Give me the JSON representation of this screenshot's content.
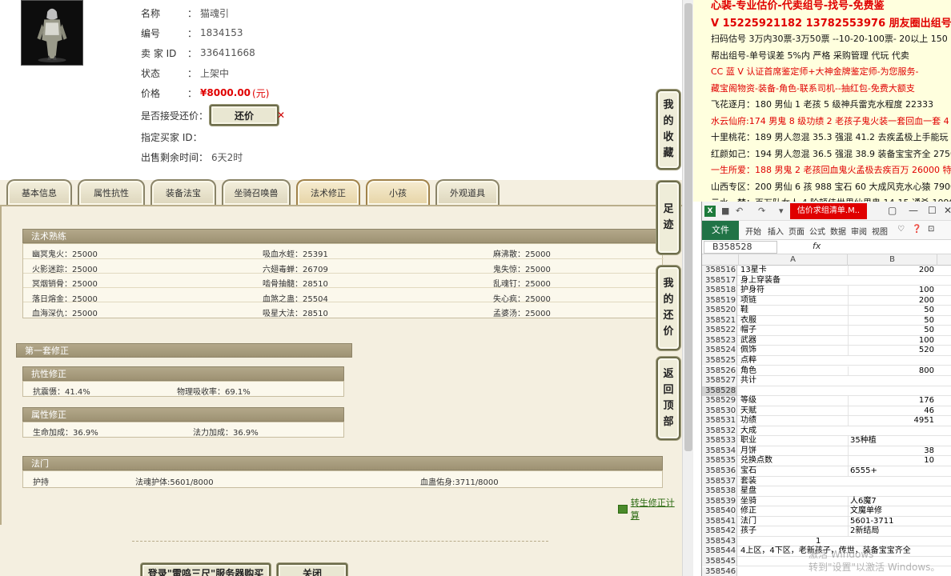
{
  "item": {
    "name_label": [
      "名",
      "称"
    ],
    "name": "猫魂引",
    "id_label": [
      "编",
      "号"
    ],
    "id": "1834153",
    "seller_label": "卖 家 ID",
    "seller_id": "336411668",
    "status_label": [
      "状",
      "态"
    ],
    "status": "上架中",
    "price_label": [
      "价",
      "格"
    ],
    "price": "¥8000.00",
    "price_unit": "(元)",
    "haggle_label": "是否接受还价：",
    "haggle_button": "还价",
    "haggle_x": "✕",
    "buyer_label": "指定买家 ID：",
    "remaining_label": "出售剩余时间：",
    "remaining": "6天2时"
  },
  "tabs": [
    "基本信息",
    "属性抗性",
    "装备法宝",
    "坐骑召唤兽",
    "法术修正",
    "小孩",
    "外观道具"
  ],
  "spell_section": {
    "title": "法术熟练",
    "rows": [
      [
        "幽冥鬼火：25000",
        "吸血水蛭：25391",
        "麻沸散：25000"
      ],
      [
        "火影迷踪：25000",
        "六翅毒蝉：26709",
        "鬼失惊：25000"
      ],
      [
        "冥烟销骨：25000",
        "啮骨抽髓：28510",
        "乱魂钉：25000"
      ],
      [
        "落日熔金：25000",
        "血煞之蛊：25504",
        "失心疯：25000"
      ],
      [
        "血海深仇：25000",
        "吸星大法：28510",
        "孟婆汤：25000"
      ]
    ]
  },
  "correction": {
    "title": "第一套修正",
    "resist_title": "抗性修正",
    "resist_values": [
      "抗震慑：41.4%",
      "物理吸收率：69.1%"
    ],
    "attr_title": "属性修正",
    "attr_values": [
      "生命加成：36.9%",
      "法力加成：36.9%"
    ]
  },
  "magic_door": {
    "title": "法门",
    "values": [
      "护持",
      "法魂护体:5601/8000",
      "血蛊佑身:3711/8000"
    ]
  },
  "side_buttons": [
    "我的收藏",
    "足迹",
    "我的还价",
    "返回顶部"
  ],
  "calc_link": "转生修正计算",
  "bottom_buttons": [
    "登录\"雷鸣三尺\"服务器购买",
    "关闭"
  ],
  "notes": [
    {
      "text": "心裴-专业估价-代卖组号-找号-免费鉴",
      "color": "red",
      "big": true
    },
    {
      "text": "V 15225921182  13782553976 朋友圈出组号",
      "color": "red",
      "big": true
    },
    {
      "text": "扫码估号 3万内30票-3万50票 --10-20-100票- 20以上 150",
      "color": "black"
    },
    {
      "text": "帮出组号-单号误差 5%内 严格 采购管理 代玩 代卖",
      "color": "black"
    },
    {
      "text": "CC 蓝 V 认证首席鉴定师+大神金牌鉴定师-为您服务-",
      "color": "red"
    },
    {
      "text": "藏宝阁物资-装备-角色-联系司机--抽红包-免费大额支",
      "color": "red"
    },
    {
      "text": "飞花逐月：180 男仙 1 老孩 5 级神兵雷克水程度 22333",
      "color": "black"
    },
    {
      "text": "水云仙府:174 男鬼 8 级功绩 2 老孩子鬼火装一套回血一套 4",
      "color": "red"
    },
    {
      "text": "十里桃花：189 男人忽混 35.3 强混 41.2 去疾孟极上手能玩 2",
      "color": "black"
    },
    {
      "text": "红颜如己：194 男人忽混 36.5 强混 38.9 装备宝宝齐全 27500",
      "color": "black"
    },
    {
      "text": "一生所爱：188 男鬼 2 老孩回血鬼火孟极去疾百万 26000 特",
      "color": "red"
    },
    {
      "text": "山西专区：200 男仙 6 孩 988 宝石 60 大成风克水心猿 79000",
      "color": "black"
    },
    {
      "text": "云水一梦：百万队女人 4 阶顿佳世男仙男鬼 14-15 通杀 1090",
      "color": "black"
    }
  ],
  "excel": {
    "doc_title": "估价求组清单.M..",
    "file_tab": "文件",
    "ribbon_tabs": [
      "开始",
      "插入",
      "页面",
      "公式",
      "数据",
      "审阅",
      "视图"
    ],
    "namebox": "B358528",
    "fx": "fx",
    "col_a": "A",
    "col_b": "B",
    "rows": [
      [
        "358516",
        "13星卡",
        "200"
      ],
      [
        "358517",
        "身上穿装备",
        ""
      ],
      [
        "358518",
        "护身符",
        "100"
      ],
      [
        "358519",
        "项链",
        "200"
      ],
      [
        "358520",
        "鞋",
        "50"
      ],
      [
        "358521",
        "衣服",
        "50"
      ],
      [
        "358522",
        "帽子",
        "50"
      ],
      [
        "358523",
        "武器",
        "100"
      ],
      [
        "358524",
        "佩饰",
        "520"
      ],
      [
        "358525",
        "点粹",
        ""
      ],
      [
        "358526",
        "角色",
        "800"
      ],
      [
        "358527",
        "共计",
        ""
      ],
      [
        "358528",
        "",
        ""
      ],
      [
        "358529",
        "等级",
        "176"
      ],
      [
        "358530",
        "天赋",
        "46"
      ],
      [
        "358531",
        "功绩",
        "4951"
      ],
      [
        "358532",
        "大成",
        ""
      ],
      [
        "358533",
        "职业",
        "35种植"
      ],
      [
        "358534",
        "月饼",
        "38"
      ],
      [
        "358535",
        "兑换点数",
        "10"
      ],
      [
        "358536",
        "宝石",
        "6555+"
      ],
      [
        "358537",
        "套装",
        ""
      ],
      [
        "358538",
        "星盘",
        ""
      ],
      [
        "358539",
        "坐骑",
        "人6魔7"
      ],
      [
        "358540",
        "修正",
        "文魔单修"
      ],
      [
        "358541",
        "法门",
        "5601-3711"
      ],
      [
        "358542",
        "孩子",
        "2新结局"
      ],
      [
        "358543",
        "",
        "1"
      ],
      [
        "358544",
        "4上区，4下区，老新孩子，传世，装备宝宝齐全",
        ""
      ],
      [
        "358545",
        "",
        ""
      ],
      [
        "358546",
        "",
        ""
      ]
    ]
  },
  "watermark": [
    "激活 Windows",
    "转到\"设置\"以激活 Windows。"
  ]
}
